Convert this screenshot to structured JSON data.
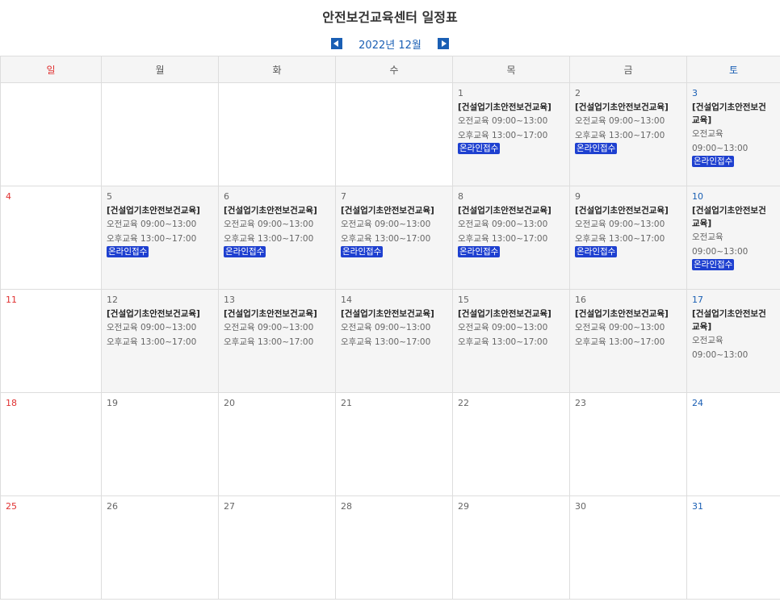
{
  "title": "안전보건교육센터 일정표",
  "nav": {
    "month_label": "2022년 12월"
  },
  "weekdays": [
    "일",
    "월",
    "화",
    "수",
    "목",
    "금",
    "토"
  ],
  "event_title": "[건설업기초안전보건교육]",
  "am_line": "오전교육 09:00~13:00",
  "pm_line": "오후교육 13:00~17:00",
  "sat_title_a": "[건설업기초안전보건교육]",
  "sat_title_b": "[건설업기초안전보건",
  "sat_title_c": "교육]",
  "sat_am_label": "오전교육",
  "sat_am_time": "09:00~13:00",
  "badge": "온라인접수",
  "days": [
    "1",
    "2",
    "3",
    "4",
    "5",
    "6",
    "7",
    "8",
    "9",
    "10",
    "11",
    "12",
    "13",
    "14",
    "15",
    "16",
    "17",
    "18",
    "19",
    "20",
    "21",
    "22",
    "23",
    "24",
    "25",
    "26",
    "27",
    "28",
    "29",
    "30",
    "31"
  ]
}
